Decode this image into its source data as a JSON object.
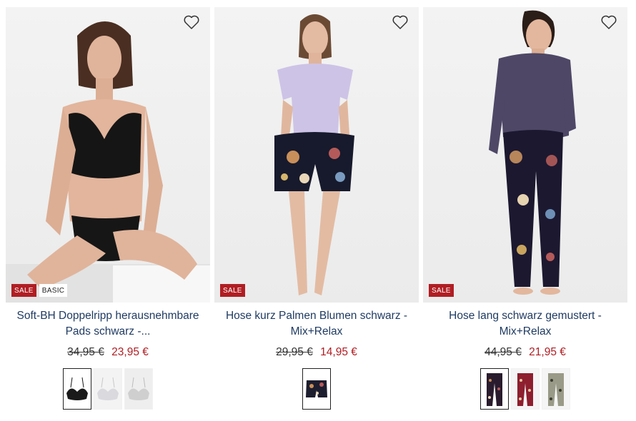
{
  "products": [
    {
      "title": "Soft-BH Doppelripp herausnehmbare Pads schwarz -...",
      "old_price": "34,95 €",
      "new_price": "23,95 €",
      "badges": [
        "SALE",
        "BASIC"
      ],
      "wishlist_icon": "heart-outline-icon",
      "swatches": [
        {
          "color": "#1a1a1a",
          "kind": "bra",
          "selected": true
        },
        {
          "color": "#d9d9de",
          "kind": "bra",
          "selected": false
        },
        {
          "color": "#cfcfcf",
          "kind": "bra",
          "selected": false
        }
      ]
    },
    {
      "title": "Hose kurz Palmen Blumen schwarz - Mix+Relax",
      "old_price": "29,95 €",
      "new_price": "14,95 €",
      "badges": [
        "SALE"
      ],
      "wishlist_icon": "heart-outline-icon",
      "swatches": [
        {
          "color": "#1c1d2e",
          "kind": "shorts",
          "selected": true
        }
      ]
    },
    {
      "title": "Hose lang schwarz gemustert - Mix+Relax",
      "old_price": "44,95 €",
      "new_price": "21,95 €",
      "badges": [
        "SALE"
      ],
      "wishlist_icon": "heart-outline-icon",
      "swatches": [
        {
          "color": "#2a1c2e",
          "kind": "pants",
          "selected": true
        },
        {
          "color": "#8e1f2e",
          "kind": "pants",
          "selected": false
        },
        {
          "color": "#9a9a88",
          "kind": "pants",
          "selected": false
        }
      ]
    }
  ],
  "colors": {
    "title": "#1f3b63",
    "sale": "#b01e23",
    "old_price": "#333333"
  }
}
